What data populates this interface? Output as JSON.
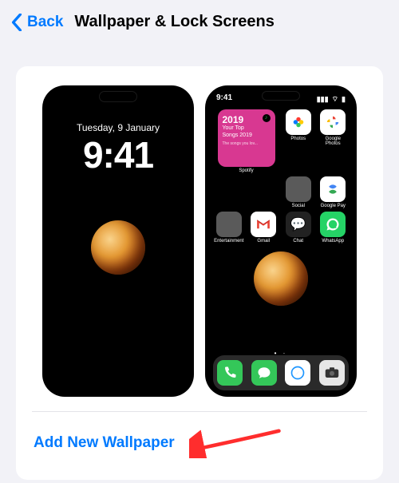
{
  "nav": {
    "back_label": "Back",
    "title": "Wallpaper & Lock Screens"
  },
  "lock": {
    "date": "Tuesday, 9 January",
    "time": "9:41"
  },
  "home": {
    "time": "9:41",
    "widget": {
      "year": "2019",
      "line1": "Your Top",
      "line2": "Songs 2019",
      "sub": "The songs you lov...",
      "caption": "Spotify"
    },
    "apps_row1": [
      {
        "label": "Photos"
      },
      {
        "label": "Google Photos"
      }
    ],
    "apps_row2": [
      {
        "label": "Social"
      },
      {
        "label": "Google Pay"
      }
    ],
    "apps_row3": [
      {
        "label": "Entertainment"
      },
      {
        "label": "Gmail"
      },
      {
        "label": "Chat"
      },
      {
        "label": "WhatsApp"
      }
    ]
  },
  "add_new_label": "Add New Wallpaper",
  "colors": {
    "accent": "#007aff",
    "arrow": "#ff2d2d"
  }
}
